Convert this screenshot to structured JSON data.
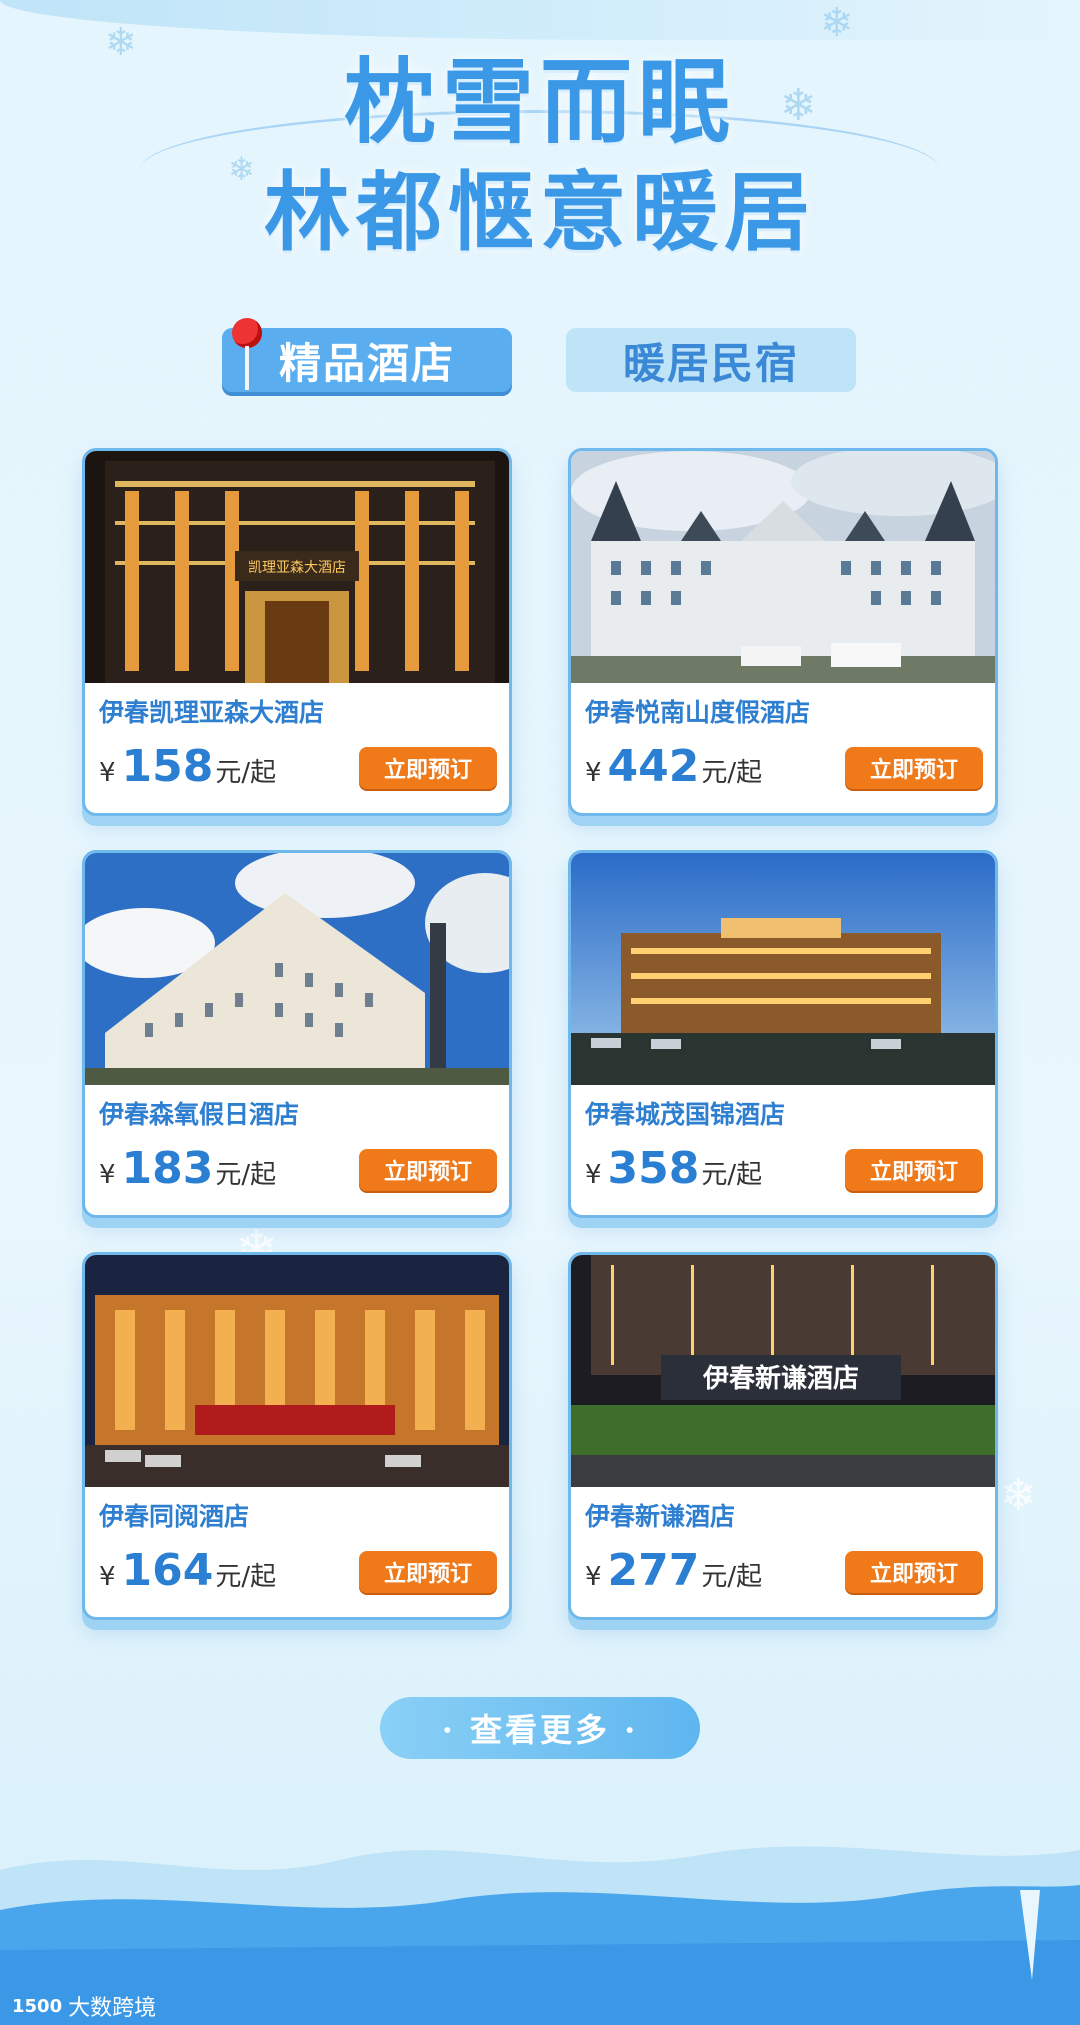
{
  "headline": {
    "line1": "枕雪而眠",
    "line2": "林都惬意暖居"
  },
  "tabs": [
    {
      "label": "精品酒店",
      "active": true
    },
    {
      "label": "暖居民宿",
      "active": false
    }
  ],
  "currency_symbol": "¥",
  "price_unit": "元/起",
  "book_label": "立即预订",
  "hotels": [
    {
      "name": "伊春凯理亚森大酒店",
      "price": "158"
    },
    {
      "name": "伊春悦南山度假酒店",
      "price": "442"
    },
    {
      "name": "伊春森氧假日酒店",
      "price": "183"
    },
    {
      "name": "伊春城茂国锦酒店",
      "price": "358"
    },
    {
      "name": "伊春同阅酒店",
      "price": "164"
    },
    {
      "name": "伊春新谦酒店",
      "price": "277"
    }
  ],
  "more_button": "· 查看更多 ·",
  "watermark": {
    "logo": "1500",
    "text": "大数跨境"
  },
  "colors": {
    "accent_blue": "#2f7fd0",
    "book_orange": "#f07a1a",
    "card_border": "#6fb8ec"
  }
}
